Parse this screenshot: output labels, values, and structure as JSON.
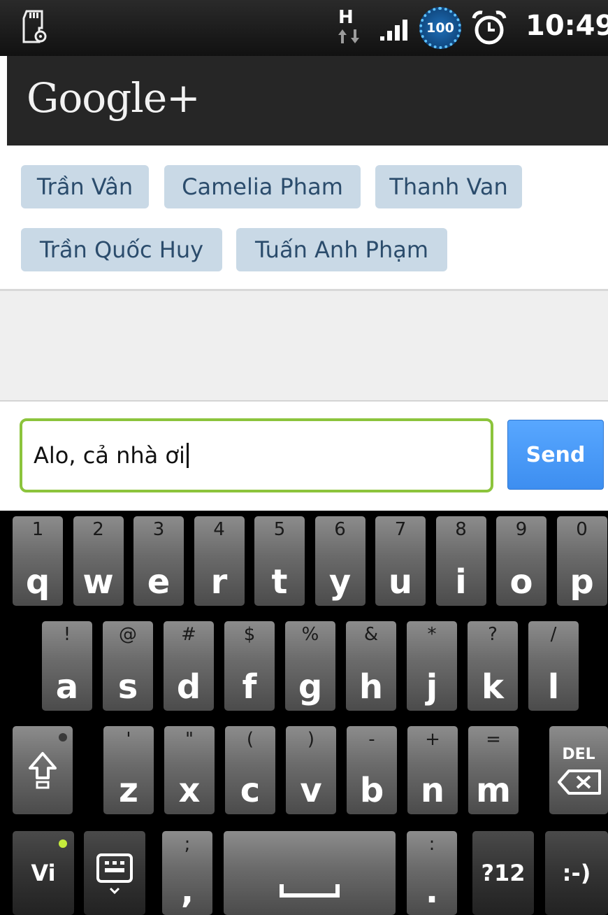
{
  "status_bar": {
    "network_type": "H",
    "battery_level": "100",
    "time": "10:49",
    "icons": [
      "sd-card-settings-icon",
      "network-arrows-icon",
      "signal-icon",
      "battery-icon",
      "alarm-icon"
    ]
  },
  "app": {
    "title": "Google+"
  },
  "recipients": [
    "Trần Vân",
    "Camelia Pham",
    "Thanh Van",
    "Trần Quốc Huy",
    "Tuấn Anh Phạm"
  ],
  "compose": {
    "message": "Alo, cả nhà ơi",
    "send_label": "Send"
  },
  "keyboard": {
    "row1": [
      {
        "hint": "1",
        "key": "q"
      },
      {
        "hint": "2",
        "key": "w"
      },
      {
        "hint": "3",
        "key": "e"
      },
      {
        "hint": "4",
        "key": "r"
      },
      {
        "hint": "5",
        "key": "t"
      },
      {
        "hint": "6",
        "key": "y"
      },
      {
        "hint": "7",
        "key": "u"
      },
      {
        "hint": "8",
        "key": "i"
      },
      {
        "hint": "9",
        "key": "o"
      },
      {
        "hint": "0",
        "key": "p"
      }
    ],
    "row2": [
      {
        "hint": "!",
        "key": "a"
      },
      {
        "hint": "@",
        "key": "s"
      },
      {
        "hint": "#",
        "key": "d"
      },
      {
        "hint": "$",
        "key": "f"
      },
      {
        "hint": "%",
        "key": "g"
      },
      {
        "hint": "&",
        "key": "h"
      },
      {
        "hint": "*",
        "key": "j"
      },
      {
        "hint": "?",
        "key": "k"
      },
      {
        "hint": "/",
        "key": "l"
      }
    ],
    "row3": [
      {
        "hint": "'",
        "key": "z"
      },
      {
        "hint": "\"",
        "key": "x"
      },
      {
        "hint": "(",
        "key": "c"
      },
      {
        "hint": ")",
        "key": "v"
      },
      {
        "hint": "-",
        "key": "b"
      },
      {
        "hint": "+",
        "key": "n"
      },
      {
        "hint": "=",
        "key": "m"
      }
    ],
    "del_label": "DEL",
    "lang_label": "Vi",
    "comma_hint": ";",
    "comma_key": ",",
    "period_hint": ":",
    "period_key": ".",
    "symbols_label": "?12",
    "smiley_label": ":-)",
    "icons": [
      "shift-icon",
      "backspace-icon",
      "keyboard-settings-icon",
      "space-icon"
    ]
  },
  "colors": {
    "chip_bg": "#c9d9e6",
    "input_border": "#8cc43c",
    "send_bg": "#3d8ef0",
    "lang_indicator": "#c6ec3c"
  }
}
